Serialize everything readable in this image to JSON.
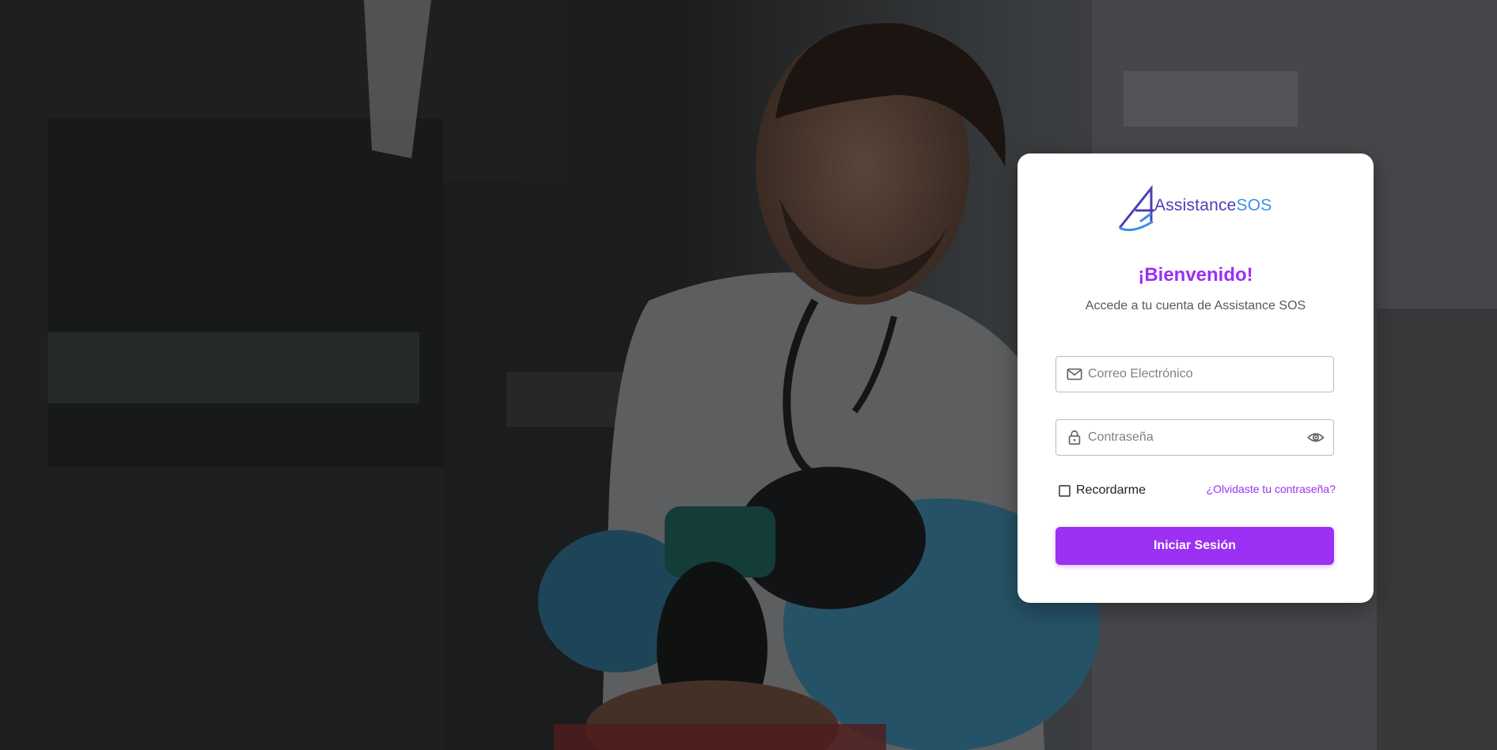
{
  "brand": {
    "name_part1": "Assistance",
    "name_part2": "SOS",
    "color_primary": "#9b30f2",
    "color_logo_dark": "#4a3fb8",
    "color_logo_light": "#3d8ee8"
  },
  "login": {
    "title": "¡Bienvenido!",
    "subtitle": "Accede a tu cuenta de Assistance SOS",
    "email": {
      "placeholder": "Correo Electrónico",
      "value": "",
      "icon": "mail-icon"
    },
    "password": {
      "placeholder": "Contraseña",
      "value": "",
      "icon": "lock-icon",
      "toggle_icon": "eye-icon"
    },
    "remember_label": "Recordarme",
    "remember_checked": false,
    "forgot_label": "¿Olvidaste tu contraseña?",
    "submit_label": "Iniciar Sesión"
  },
  "background": {
    "description_icon": "paramedic-photo"
  }
}
